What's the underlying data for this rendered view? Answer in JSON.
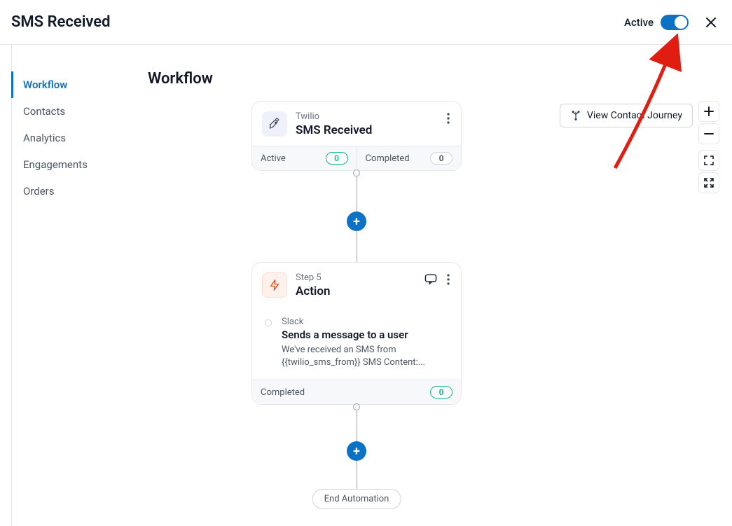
{
  "header": {
    "title": "SMS Received",
    "active_label": "Active",
    "active": true
  },
  "sidebar": {
    "items": [
      {
        "label": "Workflow",
        "active": true
      },
      {
        "label": "Contacts",
        "active": false
      },
      {
        "label": "Analytics",
        "active": false
      },
      {
        "label": "Engagements",
        "active": false
      },
      {
        "label": "Orders",
        "active": false
      }
    ]
  },
  "main": {
    "title": "Workflow",
    "journey_button": "View Contact Journey"
  },
  "trigger": {
    "provider": "Twilio",
    "title": "SMS Received",
    "stats": {
      "active_label": "Active",
      "active_count": "0",
      "completed_label": "Completed",
      "completed_count": "0"
    }
  },
  "step": {
    "supertitle": "Step 5",
    "title": "Action",
    "item": {
      "provider": "Slack",
      "title": "Sends a message to a user",
      "desc": "We've received an SMS from {{twilio_sms_from}} SMS Content:..."
    },
    "completed_label": "Completed",
    "completed_count": "0"
  },
  "end_label": "End Automation",
  "colors": {
    "accent": "#0d72c5",
    "danger": "#e11d12"
  }
}
